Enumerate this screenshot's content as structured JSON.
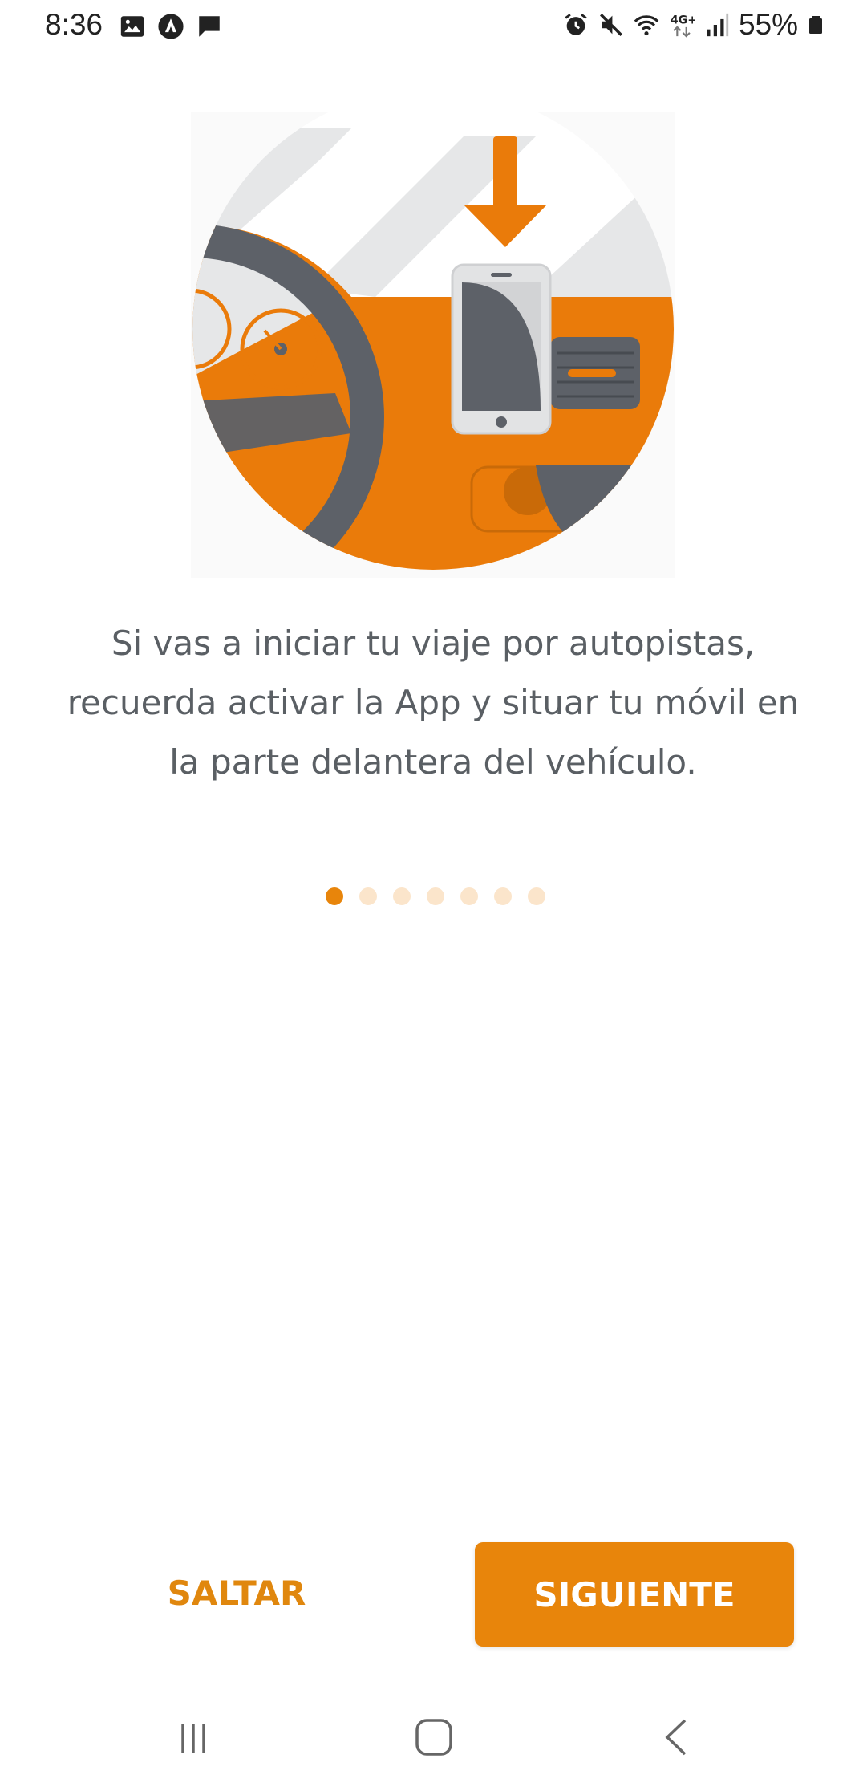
{
  "status_bar": {
    "time": "8:36",
    "battery": "55%",
    "left_icons": [
      "image-icon",
      "arrow-circle-icon",
      "message-icon"
    ],
    "right_icons": [
      "alarm-icon",
      "mute-icon",
      "wifi-icon",
      "4g-icon",
      "signal-icon",
      "battery-icon"
    ]
  },
  "onboarding": {
    "illustration": "car-dashboard-phone-illustration",
    "description": "Si vas a iniciar tu viaje por autopistas, recuerda activar la App y situar tu móvil en la parte delantera del vehículo.",
    "pages_total": 7,
    "current_page": 1
  },
  "actions": {
    "skip_label": "SALTAR",
    "next_label": "SIGUIENTE"
  },
  "nav_bar": {
    "items": [
      "recents-icon",
      "home-icon",
      "back-icon"
    ]
  },
  "colors": {
    "accent": "#e8850b",
    "dot_inactive": "#fbe5cb",
    "text": "#5a5f64"
  }
}
